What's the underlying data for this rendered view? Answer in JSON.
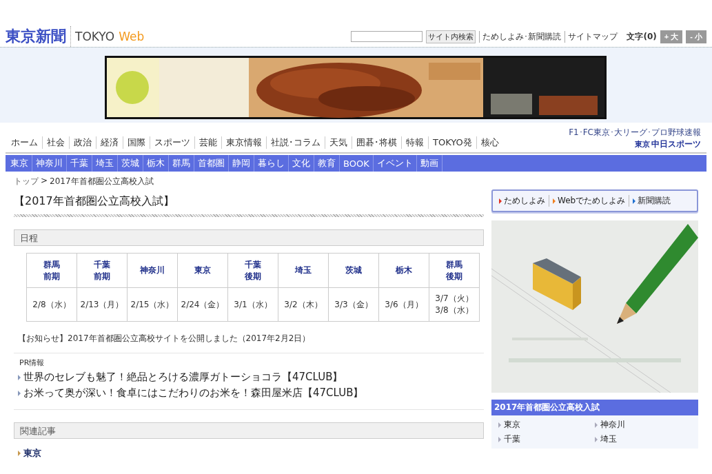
{
  "header": {
    "logo": "東京新聞",
    "logo_sub": "TOKYO",
    "logo_web": "Web",
    "search_button": "サイト内検索",
    "links": [
      "ためしよみ･新聞購読",
      "サイトマップ"
    ],
    "font_size_label": "文字(0)",
    "font_buttons": [
      "+ 大",
      "- 小"
    ]
  },
  "banner": {
    "kind": "picture"
  },
  "main_nav": [
    "ホーム",
    "社会",
    "政治",
    "経済",
    "国際",
    "スポーツ",
    "芸能",
    "東京情報",
    "社説･コラム",
    "天気",
    "囲碁･将棋",
    "特報",
    "TOKYO発",
    "核心"
  ],
  "sports_link": {
    "caption": "F1･FC東京･大リーグ･プロ野球速報",
    "small": "東京",
    "name": "中日スポーツ"
  },
  "region_nav": [
    "東京",
    "神奈川",
    "千葉",
    "埼玉",
    "茨城",
    "栃木",
    "群馬",
    "首都圏",
    "静岡",
    "暮らし",
    "文化",
    "教育",
    "BOOK",
    "イベント",
    "動画"
  ],
  "breadcrumb": {
    "items": [
      "トップ",
      "2017年首都圏公立高校入試"
    ],
    "separator": ">"
  },
  "page_title": "【2017年首都圏公立高校入試】",
  "schedule": {
    "heading": "日程",
    "columns": [
      [
        "群馬",
        "前期"
      ],
      [
        "千葉",
        "前期"
      ],
      [
        "神奈川"
      ],
      [
        "東京"
      ],
      [
        "千葉",
        "後期"
      ],
      [
        "埼玉"
      ],
      [
        "茨城"
      ],
      [
        "栃木"
      ],
      [
        "群馬",
        "後期"
      ]
    ],
    "dates": [
      "2/8（水）",
      "2/13（月）",
      "2/15（水）",
      "2/24（金）",
      "3/1（水）",
      "3/2（木）",
      "3/3（金）",
      "3/6（月）",
      "3/7（火）\n3/8（水）"
    ]
  },
  "notice": "【お知らせ】2017年首都圏公立高校サイトを公開しました（2017年2月2日）",
  "pr": {
    "label": "PR情報",
    "links": [
      "世界のセレブも魅了！絶品とろける濃厚ガトーショコラ【47CLUB】",
      "お米って奥が深い！食卓にはこだわりのお米を！森田屋米店【47CLUB】"
    ]
  },
  "related": {
    "heading": "関連記事",
    "links": [
      "東京"
    ]
  },
  "side": {
    "buttons": [
      {
        "label": "ためしよみ",
        "color": "#e03020"
      },
      {
        "label": "Webでためしよみ",
        "color": "#f08020"
      },
      {
        "label": "新聞購読",
        "color": "#2070d0"
      }
    ],
    "picture": {
      "kind": "picture"
    },
    "box_title": "2017年首都圏公立高校入試",
    "box_links": [
      "東京",
      "神奈川",
      "千葉",
      "埼玉"
    ]
  }
}
